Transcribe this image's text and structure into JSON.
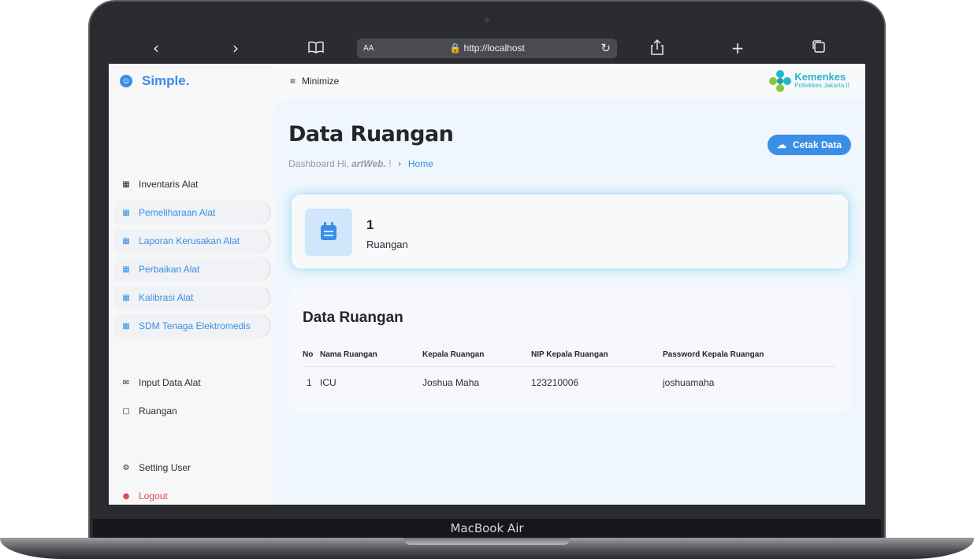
{
  "device": {
    "model": "MacBook Air"
  },
  "browser": {
    "url_prefix": "AA",
    "url": "🔒 http://localhost",
    "icons": [
      "chevron-left-icon",
      "chevron-right-icon",
      "book-icon",
      "reload-icon",
      "share-icon",
      "plus-icon",
      "tabs-icon"
    ]
  },
  "sidebar": {
    "brand": "Simple.",
    "items": [
      {
        "label": "Inventaris Alat",
        "icon": "grid-icon"
      },
      {
        "label": "Pemeliharaan Alat",
        "icon": "grid-icon"
      },
      {
        "label": "Laporan Kerusakan Alat",
        "icon": "grid-icon"
      },
      {
        "label": "Perbaikan Alat",
        "icon": "grid-icon"
      },
      {
        "label": "Kalibrasi Alat",
        "icon": "grid-icon"
      },
      {
        "label": "SDM Tenaga Elektromedis",
        "icon": "grid-icon"
      },
      {
        "label": "Input Data Alat",
        "icon": "mail-icon"
      },
      {
        "label": "Ruangan",
        "icon": "chat-icon"
      },
      {
        "label": "Setting User",
        "icon": "gear-icon"
      },
      {
        "label": "Logout",
        "icon": "power-icon"
      }
    ]
  },
  "topbar": {
    "minimize_label": "Minimize",
    "logo_title": "Kemenkes",
    "logo_subtitle": "Poltekkes Jakarta II"
  },
  "page": {
    "title": "Data Ruangan",
    "breadcrumb_prefix": "Dashboard Hi,",
    "breadcrumb_user": "artWeb.",
    "breadcrumb_suffix": "!",
    "breadcrumb_home": "Home",
    "print_button": "Cetak Data"
  },
  "stat": {
    "value": "1",
    "label": "Ruangan"
  },
  "table": {
    "title": "Data Ruangan",
    "headers": [
      "No",
      "Nama Ruangan",
      "Kepala Ruangan",
      "NIP Kepala Ruangan",
      "Password Kepala Ruangan"
    ],
    "rows": [
      [
        "1",
        "ICU",
        "Joshua Maha",
        "123210006",
        "joshuamaha"
      ]
    ]
  },
  "colors": {
    "accent": "#3a8ee6",
    "danger": "#e5484d",
    "stat_glow": "#40bee8"
  }
}
